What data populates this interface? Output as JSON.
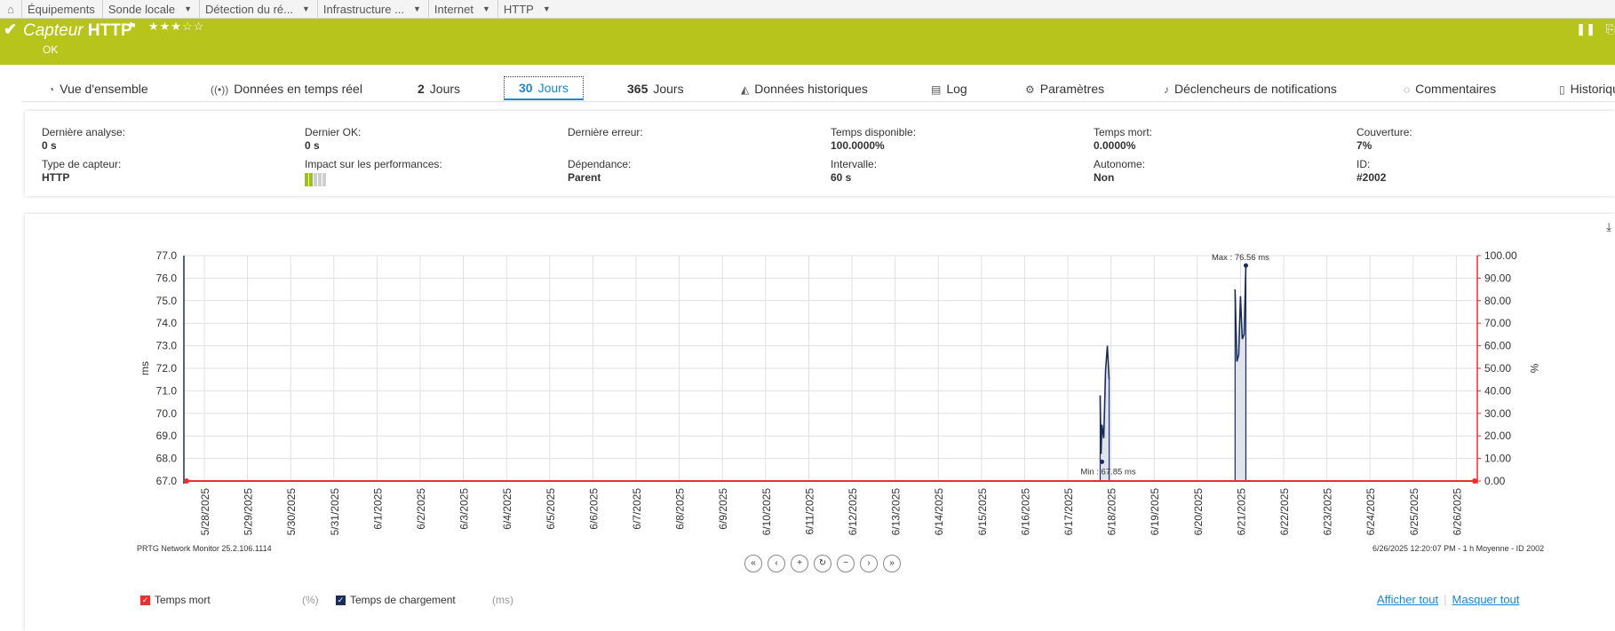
{
  "breadcrumb": {
    "home_icon": "home-icon",
    "items": [
      "Équipements",
      "Sonde locale",
      "Détection du ré...",
      "Infrastructure ...",
      "Internet",
      "HTTP"
    ]
  },
  "header": {
    "title_italic": "Capteur",
    "title_bold": "HTTP",
    "rating": "★★★☆☆",
    "rating_value": 3,
    "status": "OK",
    "bg_color": "#b7c41b"
  },
  "tabs": [
    {
      "icon": "gauge-icon",
      "glyph": "◔",
      "num": "",
      "label": "Vue d'ensemble"
    },
    {
      "icon": "broadcast-icon",
      "glyph": "((•))",
      "num": "",
      "label": "Données en temps réel"
    },
    {
      "icon": "",
      "glyph": "",
      "num": "2",
      "label": "Jours"
    },
    {
      "icon": "",
      "glyph": "",
      "num": "30",
      "label": "Jours",
      "active": true
    },
    {
      "icon": "",
      "glyph": "",
      "num": "365",
      "label": "Jours"
    },
    {
      "icon": "area-chart-icon",
      "glyph": "◭",
      "num": "",
      "label": "Données historiques"
    },
    {
      "icon": "log-icon",
      "glyph": "▤",
      "num": "",
      "label": "Log"
    },
    {
      "icon": "gear-icon",
      "glyph": "⚙",
      "num": "",
      "label": "Paramètres"
    },
    {
      "icon": "bell-icon",
      "glyph": "🔔",
      "num": "",
      "label": "Déclencheurs de notifications"
    },
    {
      "icon": "comment-icon",
      "glyph": "💬",
      "num": "",
      "label": "Commentaires"
    },
    {
      "icon": "history-icon",
      "glyph": "📄",
      "num": "",
      "label": "Historique"
    }
  ],
  "info": {
    "last_scan_label": "Dernière analyse:",
    "last_scan": "0 s",
    "last_ok_label": "Dernier OK:",
    "last_ok": "0 s",
    "last_error_label": "Dernière erreur:",
    "last_error": "",
    "uptime_label": "Temps disponible:",
    "uptime": "100.0000%",
    "downtime_label": "Temps mort:",
    "downtime": "0.0000%",
    "coverage_label": "Couverture:",
    "coverage": "7%",
    "sensor_type_label": "Type de capteur:",
    "sensor_type": "HTTP",
    "impact_label": "Impact sur les performances:",
    "impact_level": 2,
    "dependency_label": "Dépendance:",
    "dependency": "Parent",
    "interval_label": "Intervalle:",
    "interval": "60 s",
    "autonomous_label": "Autonome:",
    "autonomous": "Non",
    "id_label": "ID:",
    "id": "#2002"
  },
  "chart_data": {
    "type": "line",
    "x_labels": [
      "5/28/2025",
      "5/29/2025",
      "5/30/2025",
      "5/31/2025",
      "6/1/2025",
      "6/2/2025",
      "6/3/2025",
      "6/4/2025",
      "6/5/2025",
      "6/6/2025",
      "6/7/2025",
      "6/8/2025",
      "6/9/2025",
      "6/10/2025",
      "6/11/2025",
      "6/12/2025",
      "6/13/2025",
      "6/14/2025",
      "6/15/2025",
      "6/16/2025",
      "6/17/2025",
      "6/18/2025",
      "6/19/2025",
      "6/20/2025",
      "6/21/2025",
      "6/22/2025",
      "6/23/2025",
      "6/24/2025",
      "6/25/2025",
      "6/26/2025"
    ],
    "y_left": {
      "label": "ms",
      "min": 67.0,
      "max": 77.0,
      "ticks": [
        "77.0",
        "76.0",
        "75.0",
        "74.0",
        "73.0",
        "72.0",
        "71.0",
        "70.0",
        "69.0",
        "68.0",
        "67.0"
      ]
    },
    "y_right": {
      "label": "%",
      "min": 0,
      "max": 100,
      "ticks": [
        "100.00",
        "90.00",
        "80.00",
        "70.00",
        "60.00",
        "50.00",
        "40.00",
        "30.00",
        "20.00",
        "10.00",
        "0.00"
      ]
    },
    "series": [
      {
        "name": "Temps de chargement",
        "axis": "left",
        "color": "#1a2d5a",
        "segments": [
          [
            [
              "6/17/2025 18:00",
              70.8
            ],
            [
              "6/17/2025 18:30",
              68.2
            ],
            [
              "6/17/2025 19:00",
              69.5
            ],
            [
              "6/17/2025 20:00",
              68.9
            ],
            [
              "6/17/2025 21:00",
              71.9
            ],
            [
              "6/17/2025 22:00",
              73.0
            ],
            [
              "6/17/2025 23:00",
              71.5
            ]
          ],
          [
            [
              "6/20/2025 21:00",
              75.5
            ],
            [
              "6/20/2025 22:00",
              72.3
            ],
            [
              "6/20/2025 23:00",
              72.6
            ],
            [
              "6/21/2025 00:00",
              75.2
            ],
            [
              "6/21/2025 01:00",
              73.3
            ],
            [
              "6/21/2025 02:00",
              73.5
            ],
            [
              "6/21/2025 03:00",
              76.56
            ]
          ]
        ]
      },
      {
        "name": "Temps mort",
        "axis": "right",
        "color": "#e8312f",
        "value": 0
      }
    ],
    "annotations": {
      "min_label": "Min : 67.85 ms",
      "min_point": [
        "6/17/2025 19:00",
        67.85
      ],
      "max_label": "Max : 76.56 ms",
      "max_point": [
        "6/21/2025 03:00",
        76.56
      ]
    },
    "grid": true
  },
  "footer": {
    "left": "PRTG Network Monitor 25.2.106.1114",
    "right": "6/26/2025 12:20:07 PM - 1 h Moyenne - ID 2002"
  },
  "legend": {
    "items": [
      {
        "label": "Temps mort",
        "unit": "(%)",
        "color": "#e8312f"
      },
      {
        "label": "Temps de chargement",
        "unit": "(ms)",
        "color": "#1a2d5a"
      }
    ],
    "show_all": "Afficher tout",
    "hide_all": "Masquer tout"
  }
}
